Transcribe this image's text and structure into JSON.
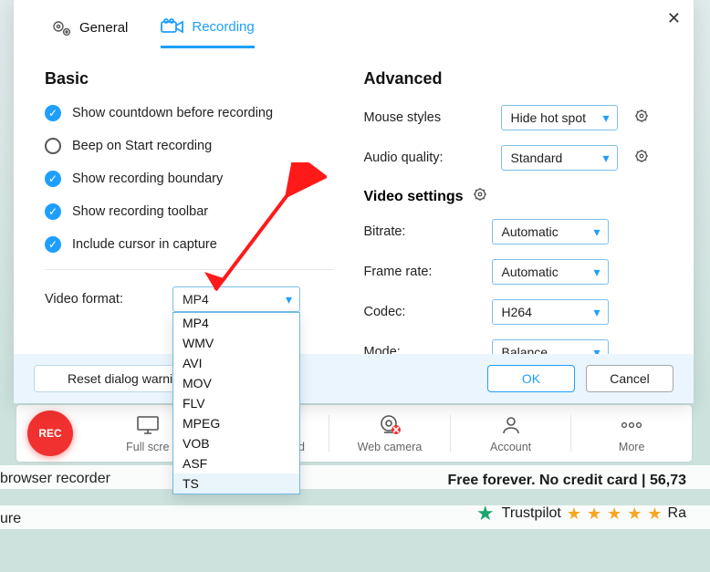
{
  "tabs": {
    "general": "General",
    "recording": "Recording"
  },
  "basic": {
    "title": "Basic",
    "items": [
      {
        "label": "Show countdown before recording",
        "checked": true
      },
      {
        "label": "Beep on Start recording",
        "checked": false
      },
      {
        "label": "Show recording boundary",
        "checked": true
      },
      {
        "label": "Show recording toolbar",
        "checked": true
      },
      {
        "label": "Include cursor in capture",
        "checked": true
      }
    ],
    "video_format_label": "Video format:",
    "video_format_value": "MP4",
    "video_format_options": [
      "MP4",
      "WMV",
      "AVI",
      "MOV",
      "FLV",
      "MPEG",
      "VOB",
      "ASF",
      "TS"
    ],
    "video_format_hovered": "TS"
  },
  "advanced": {
    "title": "Advanced",
    "mouse_styles_label": "Mouse styles",
    "mouse_styles_value": "Hide hot spot",
    "audio_quality_label": "Audio quality:",
    "audio_quality_value": "Standard",
    "video_settings_title": "Video settings",
    "bitrate_label": "Bitrate:",
    "bitrate_value": "Automatic",
    "frame_rate_label": "Frame rate:",
    "frame_rate_value": "Automatic",
    "codec_label": "Codec:",
    "codec_value": "H264",
    "mode_label": "Mode:",
    "mode_value": "Balance"
  },
  "footer": {
    "reset": "Reset dialog warni",
    "ok": "OK",
    "cancel": "Cancel"
  },
  "toolbar": {
    "rec": "REC",
    "full_screen": "Full scre",
    "system_sound": "System sound",
    "web_camera": "Web camera",
    "account": "Account",
    "more": "More"
  },
  "page": {
    "promo": "Free forever. No credit card | 56,73",
    "trust_label": "Trustpilot",
    "trust_tail": "Ra",
    "bg_text1": "browser recorder",
    "bg_text2": "ure"
  }
}
